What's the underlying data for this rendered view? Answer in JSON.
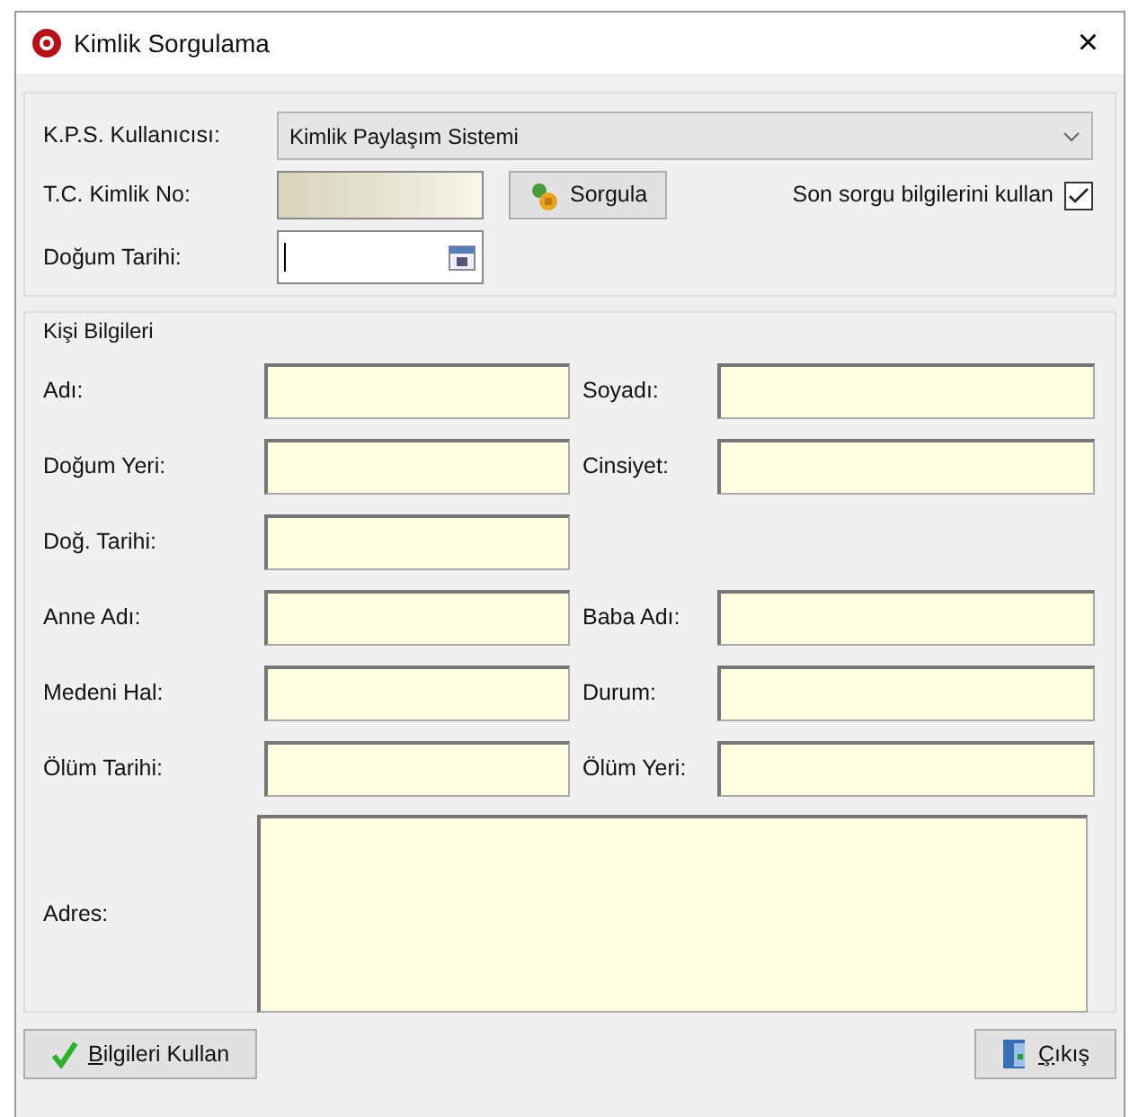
{
  "window": {
    "title": "Kimlik Sorgulama",
    "close_glyph": "×"
  },
  "query": {
    "user_label": "K.P.S. Kullanıcısı:",
    "user_value": "Kimlik Paylaşım Sistemi",
    "id_label": "T.C. Kimlik No:",
    "query_button": "Sorgula",
    "reuse_label": "Son sorgu bilgilerini kullan",
    "reuse_checked": true,
    "birth_label": "Doğum Tarihi:"
  },
  "person": {
    "title": "Kişi Bilgileri",
    "rows": [
      [
        {
          "label": "Adı:"
        },
        {
          "label": "Soyadı:"
        }
      ],
      [
        {
          "label": "Doğum Yeri:"
        },
        {
          "label": "Cinsiyet:"
        }
      ],
      [
        {
          "label": "Doğ. Tarihi:"
        }
      ],
      [
        {
          "label": "Anne Adı:"
        },
        {
          "label": "Baba Adı:"
        }
      ],
      [
        {
          "label": "Medeni Hal:"
        },
        {
          "label": "Durum:"
        }
      ],
      [
        {
          "label": "Ölüm Tarihi:"
        },
        {
          "label": "Ölüm Yeri:"
        }
      ]
    ],
    "address_label": "Adres:"
  },
  "buttons": [
    {
      "kind": "accept",
      "label": "Bilgileri Kullan",
      "access_key_shown": true
    },
    {
      "kind": "exit",
      "label": "Çıkış",
      "access_key_shown": true
    }
  ]
}
